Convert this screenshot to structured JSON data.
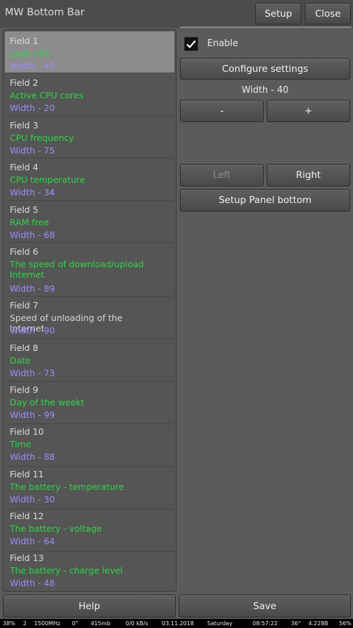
{
  "app": {
    "title": "MW Bottom Bar"
  },
  "header": {
    "setup_label": "Setup",
    "close_label": "Close"
  },
  "fields": [
    {
      "field": "Field 1",
      "name": "Load CPU",
      "width": "Width - 40",
      "active": true
    },
    {
      "field": "Field 2",
      "name": "Active CPU cores",
      "width": "Width - 20",
      "active": true
    },
    {
      "field": "Field 3",
      "name": "CPU frequency",
      "width": "Width - 75",
      "active": true
    },
    {
      "field": "Field 4",
      "name": "CPU temperature",
      "width": "Width - 34",
      "active": true
    },
    {
      "field": "Field 5",
      "name": "RAM free",
      "width": "Width - 68",
      "active": true
    },
    {
      "field": "Field 6",
      "name": "The speed of download/upload Internet",
      "width": "Width - 89",
      "active": true
    },
    {
      "field": "Field 7",
      "name": "Speed of unloading of the Internet",
      "width": "Width - 90",
      "active": false
    },
    {
      "field": "Field 8",
      "name": "Date",
      "width": "Width - 73",
      "active": true
    },
    {
      "field": "Field 9",
      "name": "Day of the weekt",
      "width": "Width - 99",
      "active": true
    },
    {
      "field": "Field 10",
      "name": "Time",
      "width": "Width - 88",
      "active": true
    },
    {
      "field": "Field 11",
      "name": "The battery - temperature",
      "width": "Width - 30",
      "active": true
    },
    {
      "field": "Field 12",
      "name": "The battery - voltage",
      "width": "Width - 64",
      "active": true
    },
    {
      "field": "Field 13",
      "name": "The battery - charge level",
      "width": "Width - 48",
      "active": true
    }
  ],
  "panel": {
    "enable_label": "Enable",
    "enable_checked": true,
    "configure_label": "Configure settings",
    "width_label": "Width - 40",
    "minus_label": "-",
    "plus_label": "+",
    "left_label": "Left",
    "right_label": "Right",
    "setup_panel_label": "Setup Panel bottom"
  },
  "footer": {
    "help_label": "Help",
    "save_label": "Save"
  },
  "statusbar": {
    "load": "38%",
    "cores": "2",
    "freq": "1500MHz",
    "cpu_temp": "0°",
    "ram": "415mb",
    "net": "0/0 kB/s",
    "date": "03.11.2018",
    "day": "Saturday",
    "time": "08:57:22",
    "bat_temp": "36°",
    "bat_volt": "4.228B",
    "bat_level": "56%"
  },
  "colors": {
    "active_name": "#2fd447",
    "inactive_name": "#d6d6d6",
    "width_text": "#9f8bff",
    "selected_row": "#8c8c8c"
  }
}
